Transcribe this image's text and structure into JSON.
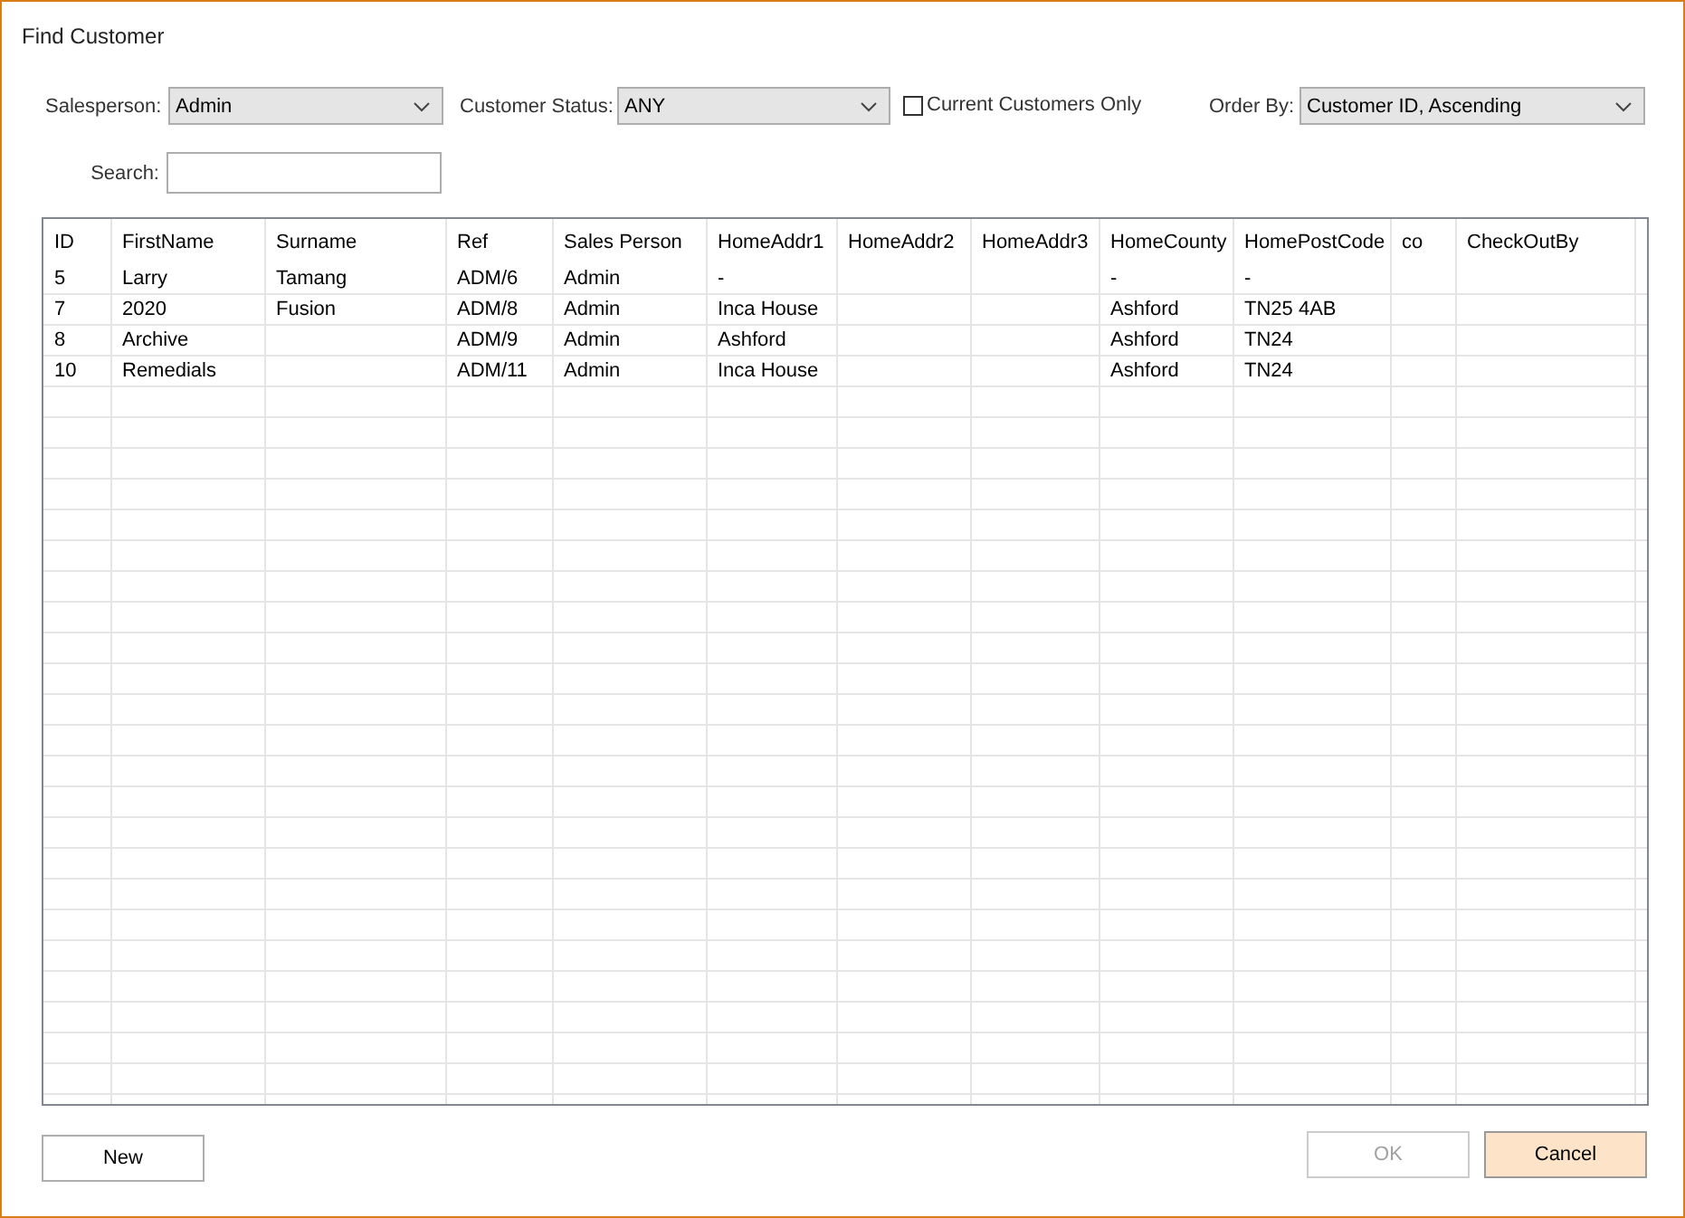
{
  "window": {
    "title": "Find Customer"
  },
  "filters": {
    "salesperson": {
      "label": "Salesperson:",
      "value": "Admin"
    },
    "customer_status": {
      "label": "Customer Status:",
      "value": "ANY"
    },
    "current_only": {
      "label": "Current Customers Only",
      "checked": false
    },
    "order_by": {
      "label": "Order By:",
      "value": "Customer ID, Ascending"
    },
    "search": {
      "label": "Search:"
    }
  },
  "table": {
    "columns": [
      "ID",
      "FirstName",
      "Surname",
      "Ref",
      "Sales Person",
      "HomeAddr1",
      "HomeAddr2",
      "HomeAddr3",
      "HomeCounty",
      "HomePostCode",
      "co",
      "CheckOutBy"
    ],
    "rows": [
      [
        "5",
        "Larry",
        "Tamang",
        "ADM/6",
        "Admin",
        "-",
        null,
        null,
        "-",
        "-",
        null,
        null
      ],
      [
        "7",
        "2020",
        "Fusion",
        "ADM/8",
        "Admin",
        "Inca House",
        null,
        null,
        "Ashford",
        "TN25 4AB",
        null,
        null
      ],
      [
        "8",
        "Archive",
        null,
        "ADM/9",
        "Admin",
        "Ashford",
        null,
        null,
        "Ashford",
        "TN24",
        null,
        null
      ],
      [
        "10",
        "Remedials",
        null,
        "ADM/11",
        "Admin",
        "Inca House",
        null,
        null,
        "Ashford",
        "TN24",
        null,
        null
      ]
    ]
  },
  "buttons": [
    {
      "label": "New",
      "disabled": false,
      "focused": false
    },
    {
      "label": "OK",
      "disabled": true,
      "focused": false
    },
    {
      "label": "Cancel",
      "disabled": false,
      "focused": true
    }
  ]
}
